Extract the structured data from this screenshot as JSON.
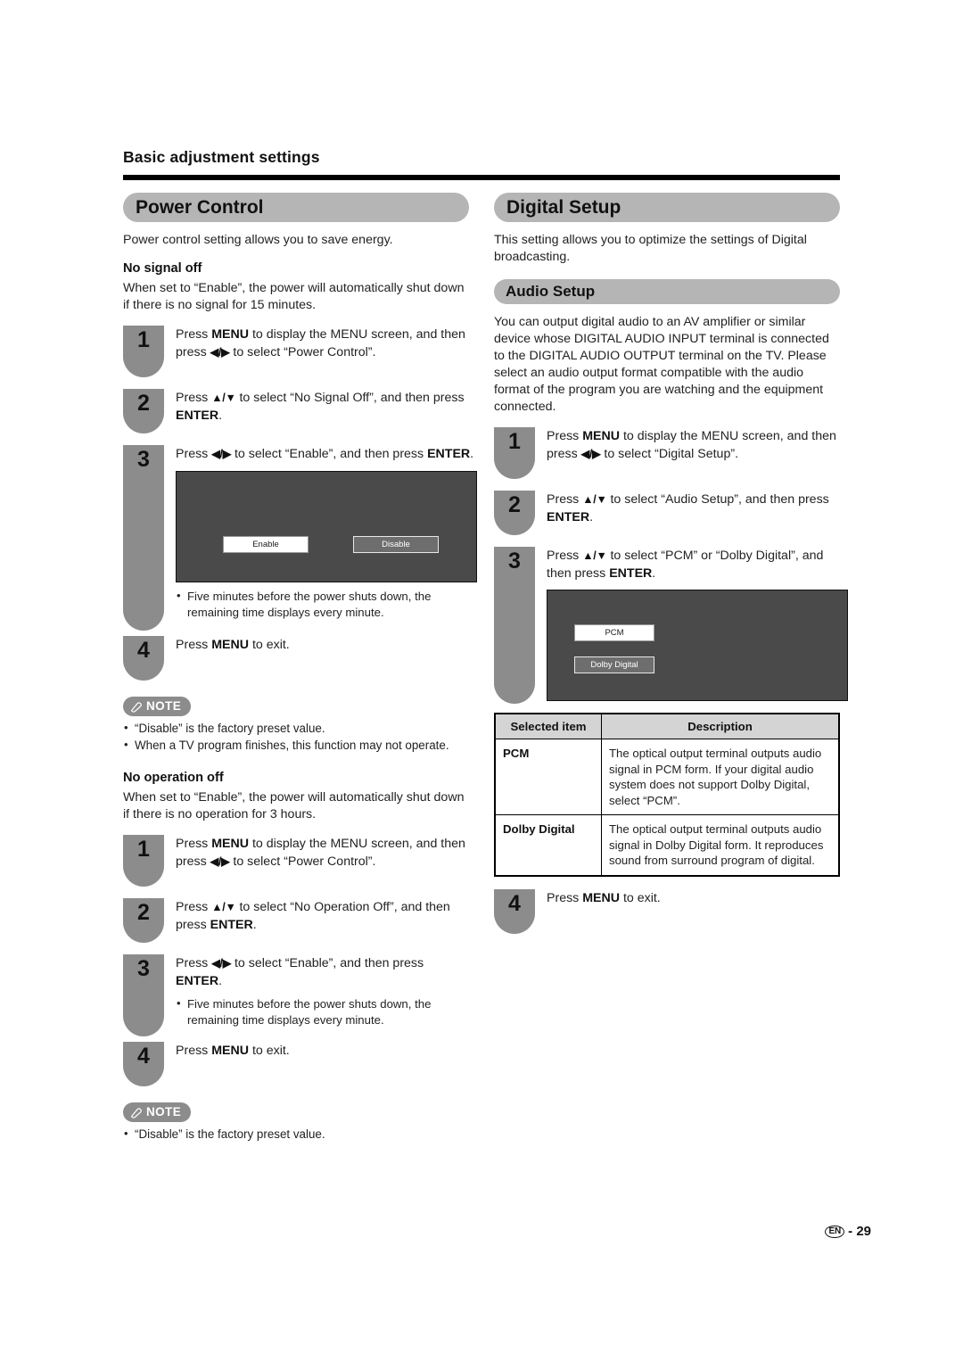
{
  "page": {
    "breadcrumb": "Basic adjustment settings",
    "footer_lang": "EN",
    "footer_sep": "-",
    "footer_page": "29"
  },
  "note_label": "NOTE",
  "left": {
    "section_title": "Power Control",
    "intro": "Power control setting allows you to save energy.",
    "no_signal": {
      "heading": "No signal off",
      "desc": "When set to “Enable”, the power will automatically shut down if there is no signal for 15 minutes.",
      "steps": [
        {
          "num": "1",
          "pre": "Press ",
          "bold1": "MENU",
          "mid": " to display the MENU screen, and then press ",
          "arrows": "◀/▶",
          "post": " to select “Power Control”."
        },
        {
          "num": "2",
          "pre": "Press ",
          "arrows": "▲/▼",
          "mid": " to select “No Signal Off”, and then press ",
          "bold1": "ENTER",
          "post": "."
        },
        {
          "num": "3",
          "pre": "Press ",
          "arrows": "◀/▶",
          "mid": " to select “Enable”, and then press ",
          "bold1": "ENTER",
          "post": "."
        },
        {
          "num": "4",
          "pre": "Press ",
          "bold1": "MENU",
          "post": " to exit."
        }
      ],
      "osd": {
        "selected": "Enable",
        "unselected": "Disable"
      },
      "bullet": "Five minutes before the power shuts down, the remaining time displays every minute.",
      "notes": [
        "“Disable” is the factory preset value.",
        "When a TV program finishes, this function may not operate."
      ]
    },
    "no_operation": {
      "heading": "No operation off",
      "desc": "When set to “Enable”, the power will automatically shut down if there is no operation for 3 hours.",
      "steps": [
        {
          "num": "1",
          "pre": "Press ",
          "bold1": "MENU",
          "mid": " to display the MENU screen, and then press ",
          "arrows": "◀/▶",
          "post": " to select “Power Control”."
        },
        {
          "num": "2",
          "pre": "Press ",
          "arrows": "▲/▼",
          "mid": " to select “No Operation Off”, and then press ",
          "bold1": "ENTER",
          "post": "."
        },
        {
          "num": "3",
          "pre": "Press ",
          "arrows": "◀/▶",
          "mid": " to select “Enable”, and then press ",
          "bold1": "ENTER",
          "post": "."
        },
        {
          "num": "4",
          "pre": "Press ",
          "bold1": "MENU",
          "post": " to exit."
        }
      ],
      "bullet": "Five minutes before the power shuts down, the remaining time displays every minute.",
      "notes": [
        "“Disable” is the factory preset value."
      ]
    }
  },
  "right": {
    "section_title": "Digital Setup",
    "intro": "This setting allows you to optimize the settings of Digital broadcasting.",
    "audio_setup": {
      "title": "Audio Setup",
      "desc": "You can output digital audio to an AV amplifier or similar device whose DIGITAL AUDIO INPUT terminal is connected to the DIGITAL AUDIO OUTPUT terminal on the TV. Please select an audio output format compatible with the audio format of the program you are watching and the equipment connected.",
      "steps": [
        {
          "num": "1",
          "pre": "Press ",
          "bold1": "MENU",
          "mid": " to display the MENU screen, and then press ",
          "arrows": "◀/▶",
          "post": " to select “Digital Setup”."
        },
        {
          "num": "2",
          "pre": "Press ",
          "arrows": "▲/▼",
          "mid": " to select “Audio Setup”, and then press ",
          "bold1": "ENTER",
          "post": "."
        },
        {
          "num": "3",
          "pre": "Press ",
          "arrows": "▲/▼",
          "mid": " to select “PCM” or “Dolby Digital”, and then press ",
          "bold1": "ENTER",
          "post": "."
        },
        {
          "num": "4",
          "pre": "Press ",
          "bold1": "MENU",
          "post": " to exit."
        }
      ],
      "osd": {
        "selected": "PCM",
        "unselected": "Dolby Digital"
      },
      "table": {
        "headers": [
          "Selected item",
          "Description"
        ],
        "rows": [
          {
            "item": "PCM",
            "description": "The optical output terminal outputs audio signal in PCM form. If your digital audio system does not support Dolby Digital, select “PCM”."
          },
          {
            "item": "Dolby Digital",
            "description": "The optical output terminal outputs audio signal in Dolby Digital form. It reproduces sound from surround program of digital."
          }
        ]
      }
    }
  }
}
